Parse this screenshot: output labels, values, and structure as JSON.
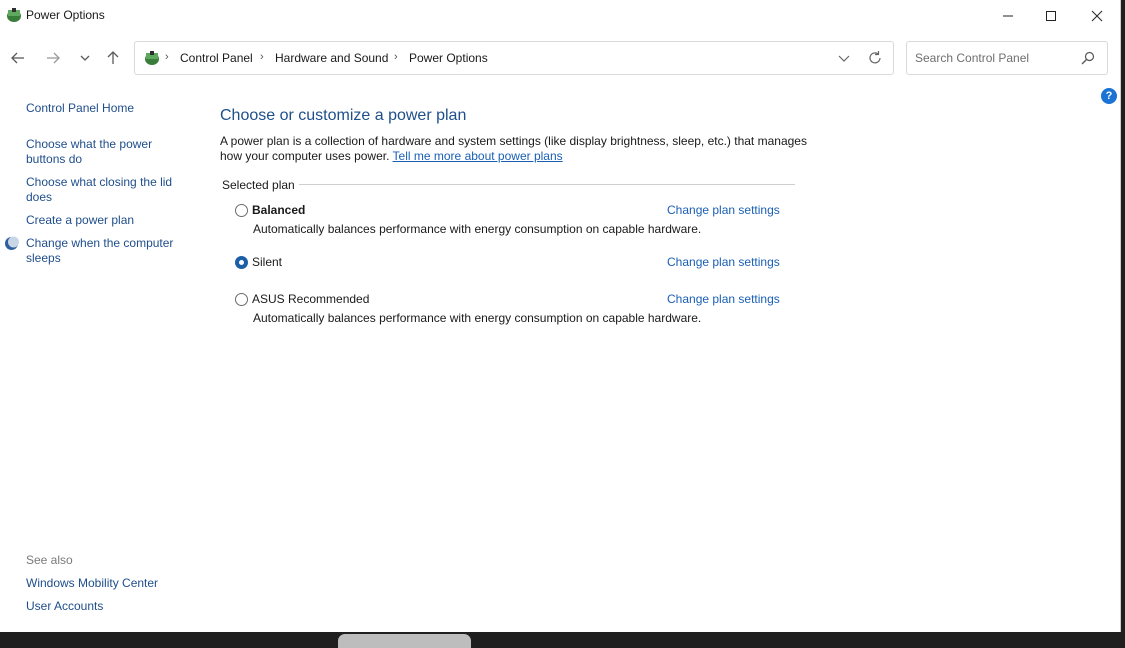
{
  "window": {
    "title": "Power Options"
  },
  "address": {
    "crumbs": [
      "Control Panel",
      "Hardware and Sound",
      "Power Options"
    ],
    "search_placeholder": "Search Control Panel"
  },
  "sidebar": {
    "home": "Control Panel Home",
    "links": [
      "Choose what the power buttons do",
      "Choose what closing the lid does",
      "Create a power plan",
      "Change when the computer sleeps"
    ],
    "see_also_label": "See also",
    "see_also_links": [
      "Windows Mobility Center",
      "User Accounts"
    ]
  },
  "main": {
    "title": "Choose or customize a power plan",
    "description": "A power plan is a collection of hardware and system settings (like display brightness, sleep, etc.) that manages how your computer uses power.",
    "description_link": "Tell me more about power plans",
    "group_label": "Selected plan",
    "plans": [
      {
        "name": "Balanced",
        "description": "Automatically balances performance with energy consumption on capable hardware.",
        "link": "Change plan settings",
        "selected": false
      },
      {
        "name": "Silent",
        "description": "",
        "link": "Change plan settings",
        "selected": true
      },
      {
        "name": "ASUS Recommended",
        "description": "Automatically balances performance with energy consumption on capable hardware.",
        "link": "Change plan settings",
        "selected": false
      }
    ]
  },
  "help": {
    "glyph": "?"
  },
  "colors": {
    "link": "#1a5fb4",
    "title": "#1e4f8a",
    "radio_selected": "#1b5fa8"
  }
}
